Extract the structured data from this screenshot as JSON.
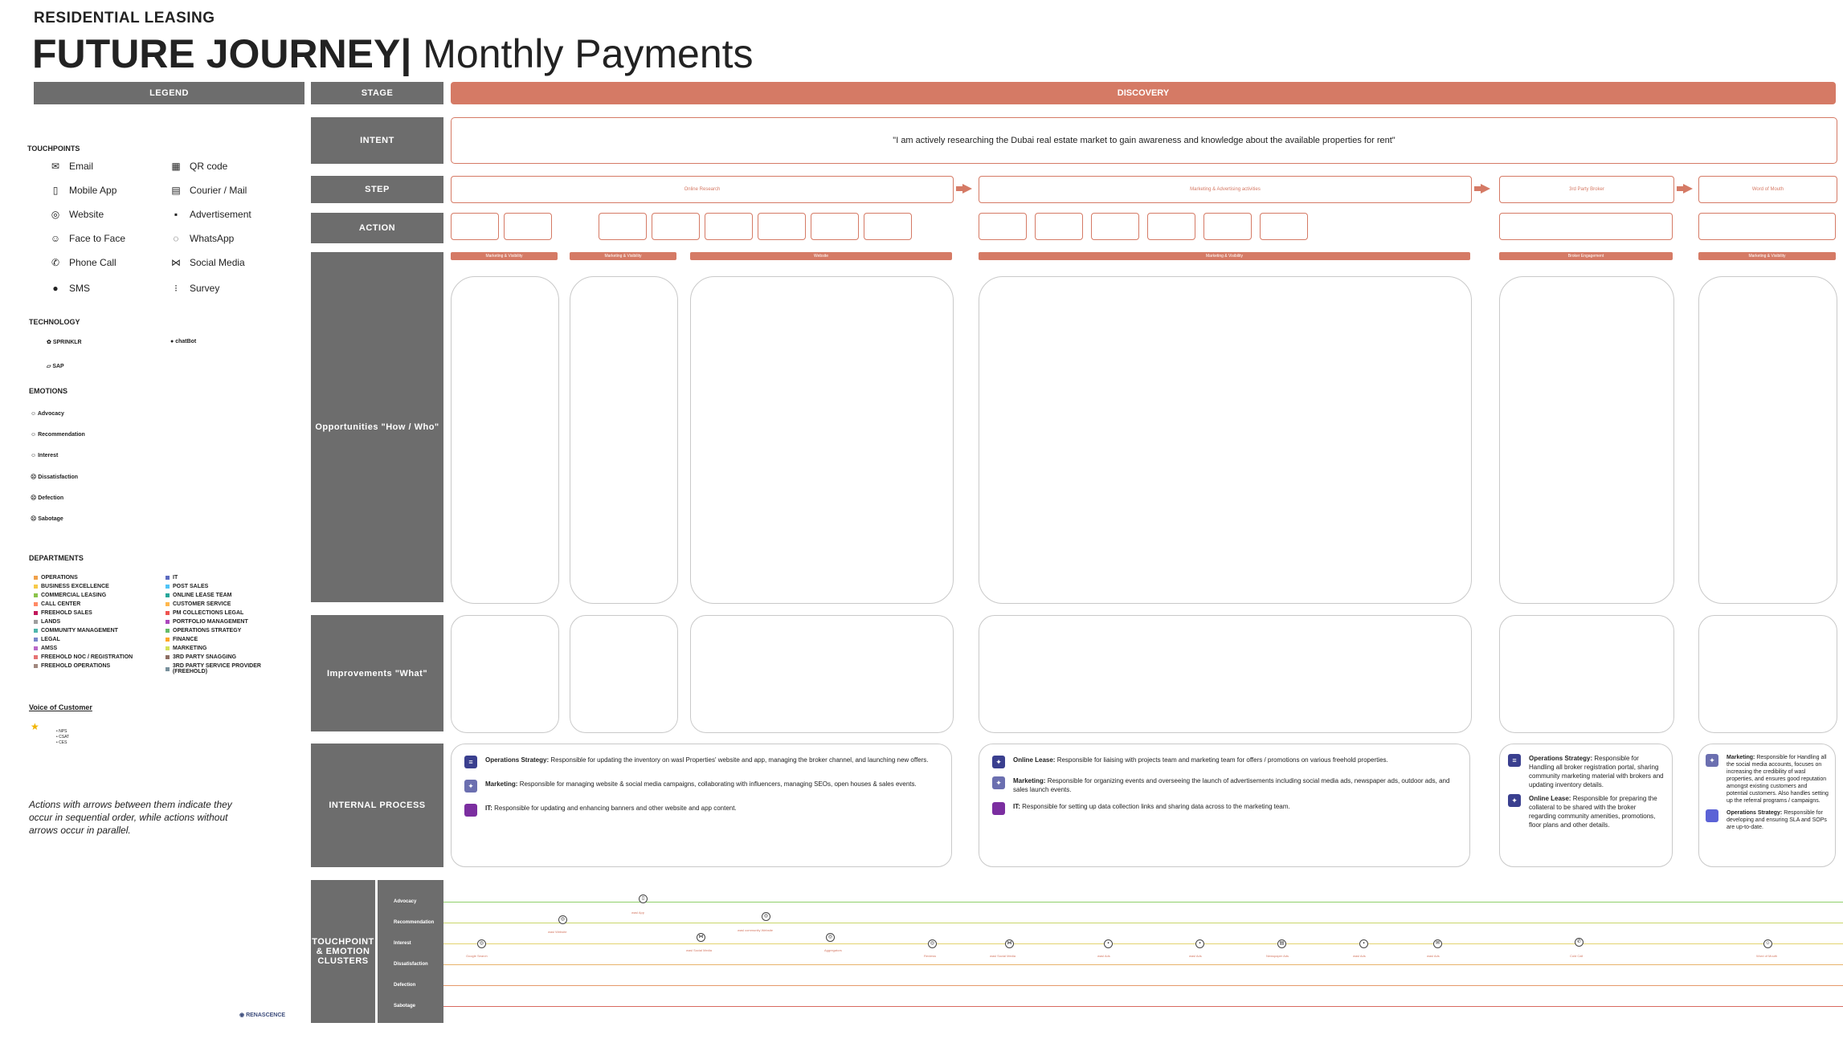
{
  "header": {
    "kicker": "RESIDENTIAL LEASING",
    "title_bold": "FUTURE JOURNEY",
    "title_sep": "|",
    "title_light": "Monthly Payments"
  },
  "columns": {
    "legend": "LEGEND",
    "stage": "STAGE",
    "discovery": "DISCOVERY"
  },
  "rows": {
    "intent": "INTENT",
    "step": "STEP",
    "action": "ACTION",
    "opportunities": "Opportunities \"How / Who\"",
    "improvements": "Improvements \"What\"",
    "internal_process": "INTERNAL PROCESS",
    "touchpoint_clusters": "TOUCHPOINT & EMOTION CLUSTERS"
  },
  "intent_text": "\"I am actively researching the Dubai real estate market to gain awareness and knowledge about the available properties for rent\"",
  "steps": [
    "Online Research",
    "Marketing & Advertising activities",
    "3rd Party Broker",
    "Word of Mouth"
  ],
  "legend": {
    "touchpoints_title": "TOUCHPOINTS",
    "touchpoints": [
      {
        "label": "Email",
        "icon": "email-icon"
      },
      {
        "label": "QR code",
        "icon": "qr-code-icon"
      },
      {
        "label": "Mobile App",
        "icon": "mobile-app-icon"
      },
      {
        "label": "Courier / Mail",
        "icon": "courier-icon"
      },
      {
        "label": "Website",
        "icon": "website-icon"
      },
      {
        "label": "Advertisement",
        "icon": "advertisement-icon"
      },
      {
        "label": "Face to Face",
        "icon": "face-to-face-icon"
      },
      {
        "label": "WhatsApp",
        "icon": "whatsapp-icon"
      },
      {
        "label": "Phone Call",
        "icon": "phone-icon"
      },
      {
        "label": "Social Media",
        "icon": "social-media-icon"
      },
      {
        "label": "SMS",
        "icon": "sms-icon"
      },
      {
        "label": "Survey",
        "icon": "survey-icon"
      }
    ],
    "technology_title": "TECHNOLOGY",
    "technology": [
      "SPRINKLR",
      "chatBot",
      "SAP"
    ],
    "emotions_title": "EMOTIONS",
    "emotions": [
      "Advocacy",
      "Recommendation",
      "Interest",
      "Dissatisfaction",
      "Defection",
      "Sabotage"
    ],
    "departments_title": "DEPARTMENTS",
    "departments_left": [
      "OPERATIONS",
      "BUSINESS EXCELLENCE",
      "COMMERCIAL LEASING",
      "CALL CENTER",
      "FREEHOLD SALES",
      "LANDS",
      "COMMUNITY MANAGEMENT",
      "LEGAL",
      "AMSS",
      "FREEHOLD NOC / REGISTRATION",
      "FREEHOLD OPERATIONS"
    ],
    "departments_right": [
      "IT",
      "POST SALES",
      "ONLINE LEASE TEAM",
      "CUSTOMER SERVICE",
      "PM COLLECTIONS LEGAL",
      "PORTFOLIO MANAGEMENT",
      "OPERATIONS STRATEGY",
      "FINANCE",
      "MARKETING",
      "3RD PARTY SNAGGING",
      "3RD PARTY SERVICE PROVIDER (FREEHOLD)"
    ],
    "voc_title": "Voice of Customer",
    "voc_items": [
      "NPS",
      "CSAT",
      "CES"
    ],
    "note": "Actions with arrows between them indicate they occur in sequential order, while actions without arrows occur in parallel."
  },
  "opportunity_categories": [
    "Marketing & Visibility",
    "Marketing & Visibility",
    "Website",
    "Marketing & Visibility",
    "Broker Engagement",
    "Marketing & Visibility"
  ],
  "internal_process": {
    "block1": [
      {
        "label": "Operations Strategy:",
        "text": "Responsible for updating the inventory on wasl Properties' website and app, managing the broker channel, and launching new offers."
      },
      {
        "label": "Marketing:",
        "text": "Responsible for managing website & social media campaigns, collaborating with influencers, managing SEOs, open houses & sales events."
      },
      {
        "label": "IT:",
        "text": "Responsible for updating and enhancing banners and other website and app content."
      }
    ],
    "block2": [
      {
        "label": "Online Lease:",
        "text": "Responsible for liaising with projects team and marketing team for offers / promotions on various freehold properties."
      },
      {
        "label": "Marketing:",
        "text": "Responsible for organizing events and overseeing the launch of advertisements including social media ads, newspaper ads, outdoor ads, and sales launch events."
      },
      {
        "label": "IT:",
        "text": "Responsible for setting up data collection links and sharing data across to the marketing team."
      }
    ],
    "block3": [
      {
        "label": "Operations Strategy:",
        "text": "Responsible for Handling all broker registration portal, sharing community marketing material with brokers and updating inventory details."
      },
      {
        "label": "Online Lease:",
        "text": "Responsible for preparing the collateral to be shared with the broker regarding community amenities, promotions, floor plans and other details."
      }
    ],
    "block4": [
      {
        "label": "Marketing:",
        "text": "Responsible for Handling all the social media accounts, focuses on increasing the credibility of wasl properties, and ensures good reputation amongst existing customers and potential customers. Also handles setting up the referral programs / campaigns."
      },
      {
        "label": "Operations Strategy:",
        "text": "Responsible for developing and ensuring SLA and SOPs are up-to-date."
      }
    ]
  },
  "clusters": [
    "Advocacy",
    "Recommendation",
    "Interest",
    "Dissatisfaction",
    "Defection",
    "Sabotage"
  ],
  "cluster_touchpoints": [
    "Google Search",
    "wasl Website",
    "wasl App",
    "wasl Social Media",
    "wasl community Website",
    "Aggregators",
    "Reviews",
    "wasl Social Media",
    "wasl Ads",
    "wasl Ads",
    "Newspaper Ads",
    "wasl Ads",
    "wasl Ads",
    "Cold Call",
    "Word of Mouth"
  ],
  "colors": {
    "accent": "#d57a65",
    "header_gray": "#6d6d6d",
    "process_icon": "#3a3f8f"
  },
  "logo": "RENASCENCE"
}
